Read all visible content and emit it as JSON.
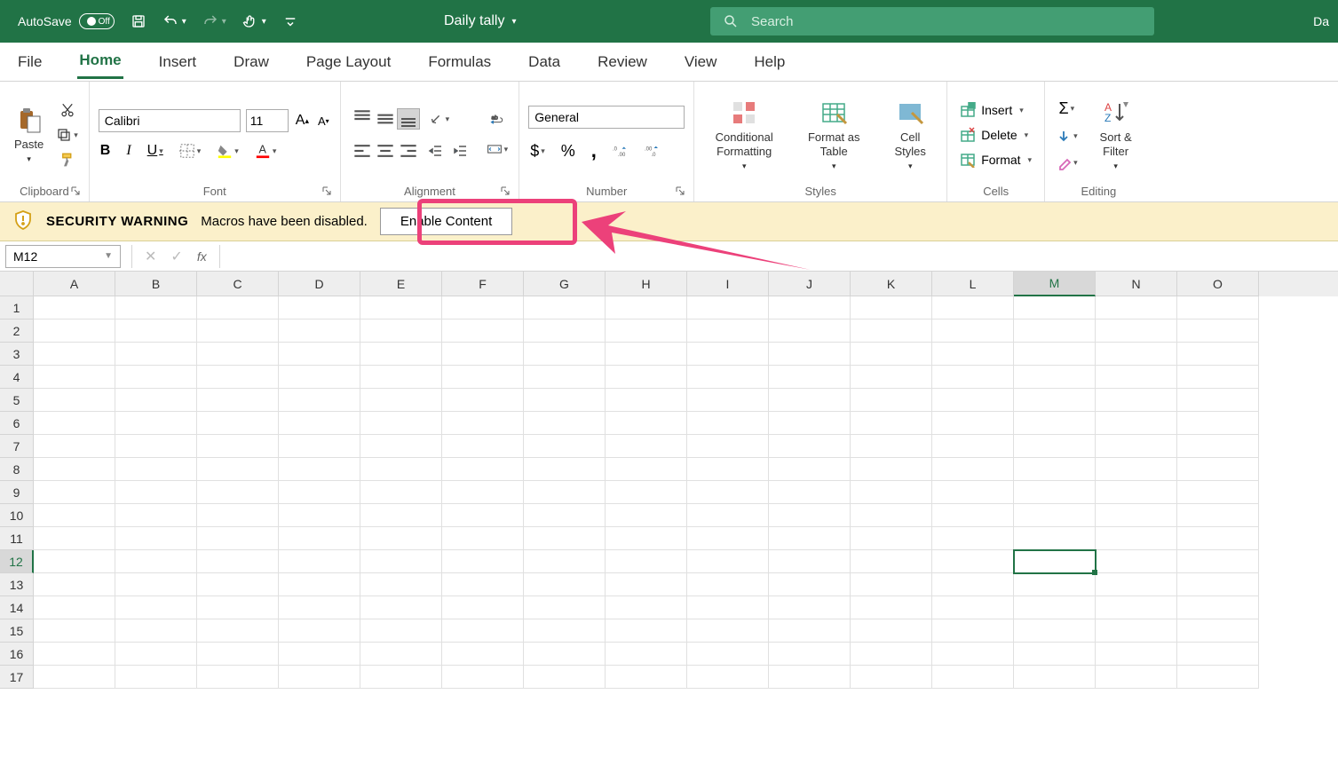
{
  "title_bar": {
    "autosave_label": "AutoSave",
    "autosave_state": "Off",
    "doc_title": "Daily tally",
    "search_placeholder": "Search",
    "right_text": "Da"
  },
  "tabs": [
    "File",
    "Home",
    "Insert",
    "Draw",
    "Page Layout",
    "Formulas",
    "Data",
    "Review",
    "View",
    "Help"
  ],
  "active_tab": "Home",
  "ribbon": {
    "clipboard": {
      "label": "Clipboard",
      "paste": "Paste"
    },
    "font": {
      "label": "Font",
      "name": "Calibri",
      "size": "11"
    },
    "alignment": {
      "label": "Alignment"
    },
    "number": {
      "label": "Number",
      "format": "General"
    },
    "styles": {
      "label": "Styles",
      "conditional": "Conditional Formatting",
      "table": "Format as Table",
      "cell": "Cell Styles"
    },
    "cells": {
      "label": "Cells",
      "insert": "Insert",
      "delete": "Delete",
      "format": "Format"
    },
    "editing": {
      "label": "Editing",
      "sort": "Sort & Filter"
    }
  },
  "security": {
    "title": "SECURITY WARNING",
    "message": "Macros have been disabled.",
    "button": "Enable Content"
  },
  "formula_bar": {
    "name_box": "M12",
    "fx": "fx"
  },
  "grid": {
    "columns": [
      "A",
      "B",
      "C",
      "D",
      "E",
      "F",
      "G",
      "H",
      "I",
      "J",
      "K",
      "L",
      "M",
      "N",
      "O"
    ],
    "rows": [
      "1",
      "2",
      "3",
      "4",
      "5",
      "6",
      "7",
      "8",
      "9",
      "10",
      "11",
      "12",
      "13",
      "14",
      "15",
      "16",
      "17"
    ],
    "active_col": "M",
    "active_row": "12"
  }
}
